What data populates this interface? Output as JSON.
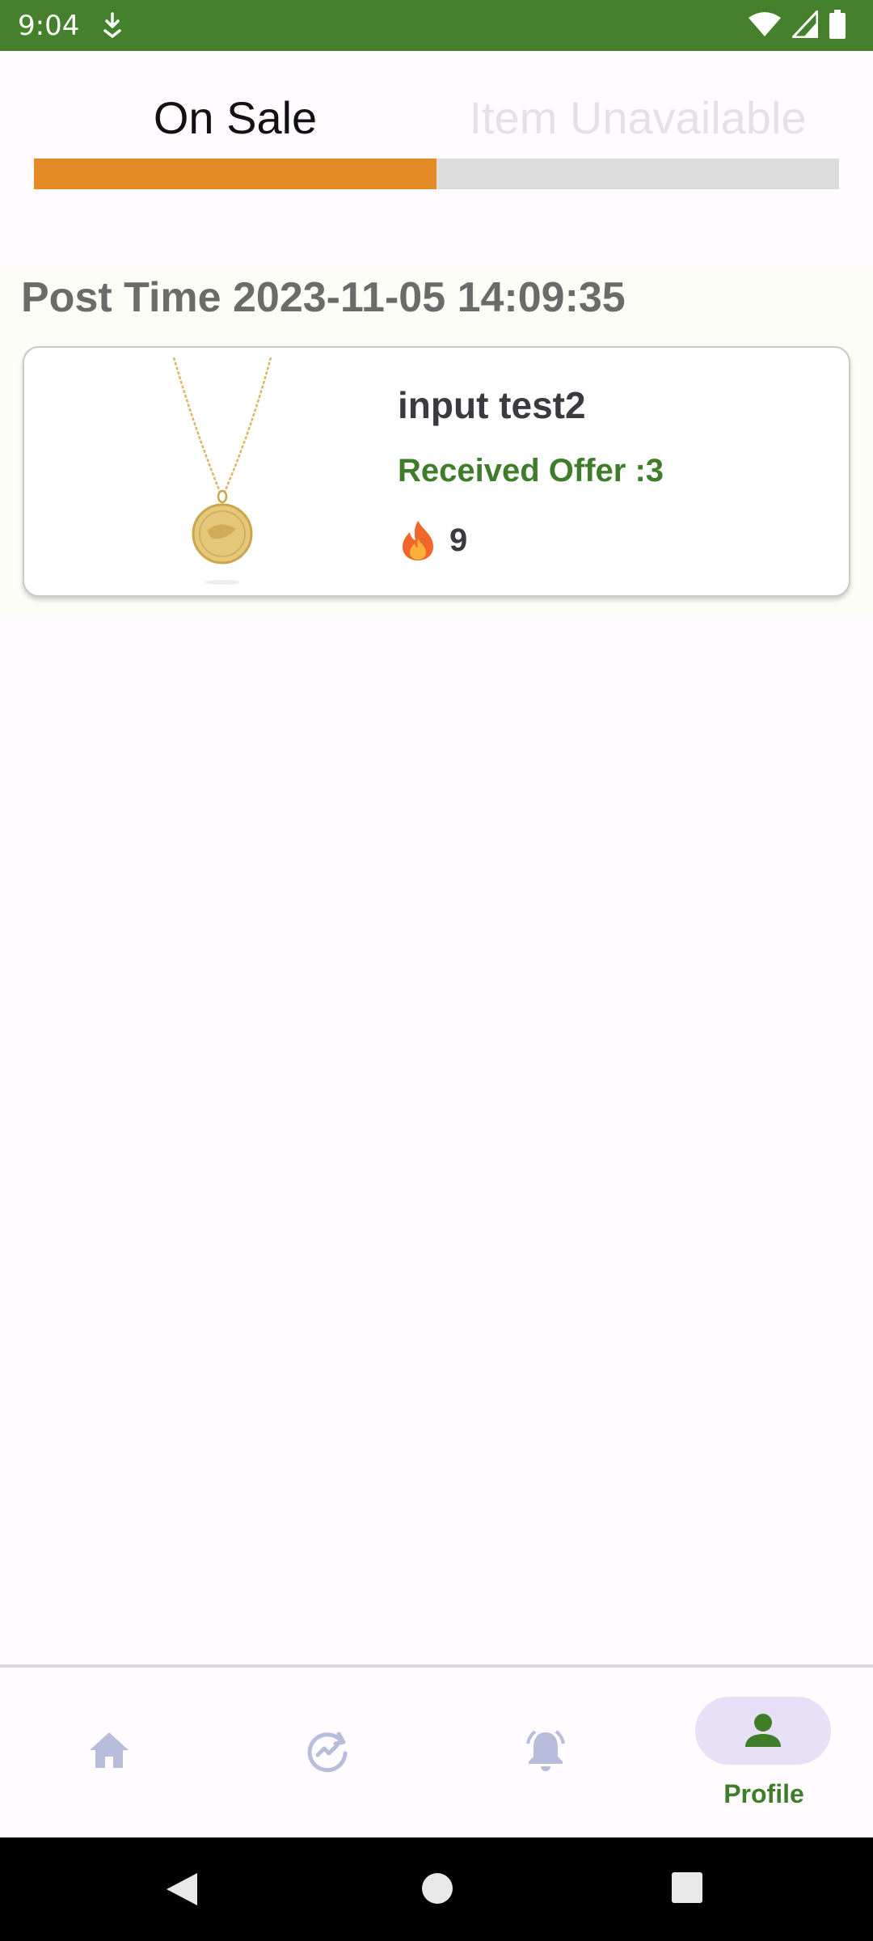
{
  "status_bar": {
    "time": "9:04"
  },
  "tabs": {
    "items": [
      {
        "label": "On Sale",
        "selected": true
      },
      {
        "label": "Item Unavailable",
        "selected": false
      }
    ],
    "indicator_fraction": 0.5,
    "indicator_color": "#e48a26"
  },
  "listing": {
    "post_time": "Post Time 2023-11-05 14:09:35",
    "card": {
      "title": "input test2",
      "offer_text": "Received Offer :3",
      "heat_icon": "fire-icon",
      "heat_count": "9"
    }
  },
  "bottom_nav": {
    "items": [
      {
        "icon": "home-icon",
        "label": ""
      },
      {
        "icon": "trend-sync-icon",
        "label": ""
      },
      {
        "icon": "bell-icon",
        "label": ""
      },
      {
        "icon": "person-icon",
        "label": "Profile",
        "active": true
      }
    ],
    "active_color": "#3f7d2a"
  },
  "colors": {
    "status_bar": "#45802c",
    "accent": "#e48a26",
    "offer": "#3f7d2a"
  }
}
